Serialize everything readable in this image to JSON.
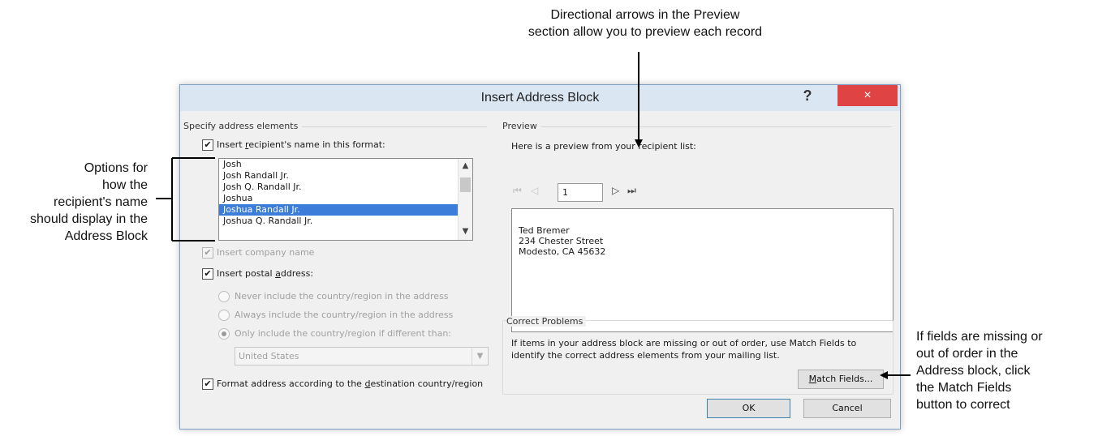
{
  "callouts": {
    "top": [
      "Directional arrows in the Preview",
      "section allow you to preview each record"
    ],
    "left": [
      "Options for",
      "how the",
      "recipient's name",
      "should display in the",
      "Address Block"
    ],
    "right": [
      "If fields are missing or",
      "out of order in the",
      "Address block, click",
      "the Match Fields",
      "button to correct"
    ]
  },
  "dialog": {
    "title": "Insert Address Block",
    "help": "?",
    "close": "×",
    "specify": {
      "label": "Specify address elements",
      "recipient_name": {
        "checked": true,
        "label_pre": "Insert ",
        "label_key": "r",
        "label_post": "ecipient's name in this format:"
      },
      "name_formats": [
        "Josh",
        "Josh Randall Jr.",
        "Josh Q. Randall Jr.",
        "Joshua",
        "Joshua Randall Jr.",
        "Joshua Q. Randall Jr."
      ],
      "selected_format": "Joshua Randall Jr.",
      "company_name": {
        "checked": true,
        "enabled": false,
        "label": "Insert company name"
      },
      "postal_address": {
        "checked": true,
        "label_pre": "Insert postal ",
        "label_key": "a",
        "label_post": "ddress:"
      },
      "country_options": [
        {
          "label": "Never include the country/region in the address",
          "selected": false
        },
        {
          "label": "Always include the country/region in the address",
          "selected": false
        },
        {
          "label": "Only include the country/region if different than:",
          "selected": true
        }
      ],
      "country_value": "United States",
      "format_destination": {
        "checked": true,
        "label_pre": "Format address according to the ",
        "label_key": "d",
        "label_post": "estination country/region"
      }
    },
    "preview": {
      "label": "Preview",
      "intro": "Here is a preview from your recipient list:",
      "record": "1",
      "address_lines": [
        "Ted Bremer",
        "234 Chester Street",
        "Modesto, CA 45632"
      ]
    },
    "correct": {
      "label": "Correct Problems",
      "text_line1": "If items in your address block are missing or out of order, use Match Fields to",
      "text_line2": "identify the correct address elements from your mailing list.",
      "match_key": "M",
      "match_rest": "atch Fields..."
    },
    "ok": "OK",
    "cancel": "Cancel"
  }
}
